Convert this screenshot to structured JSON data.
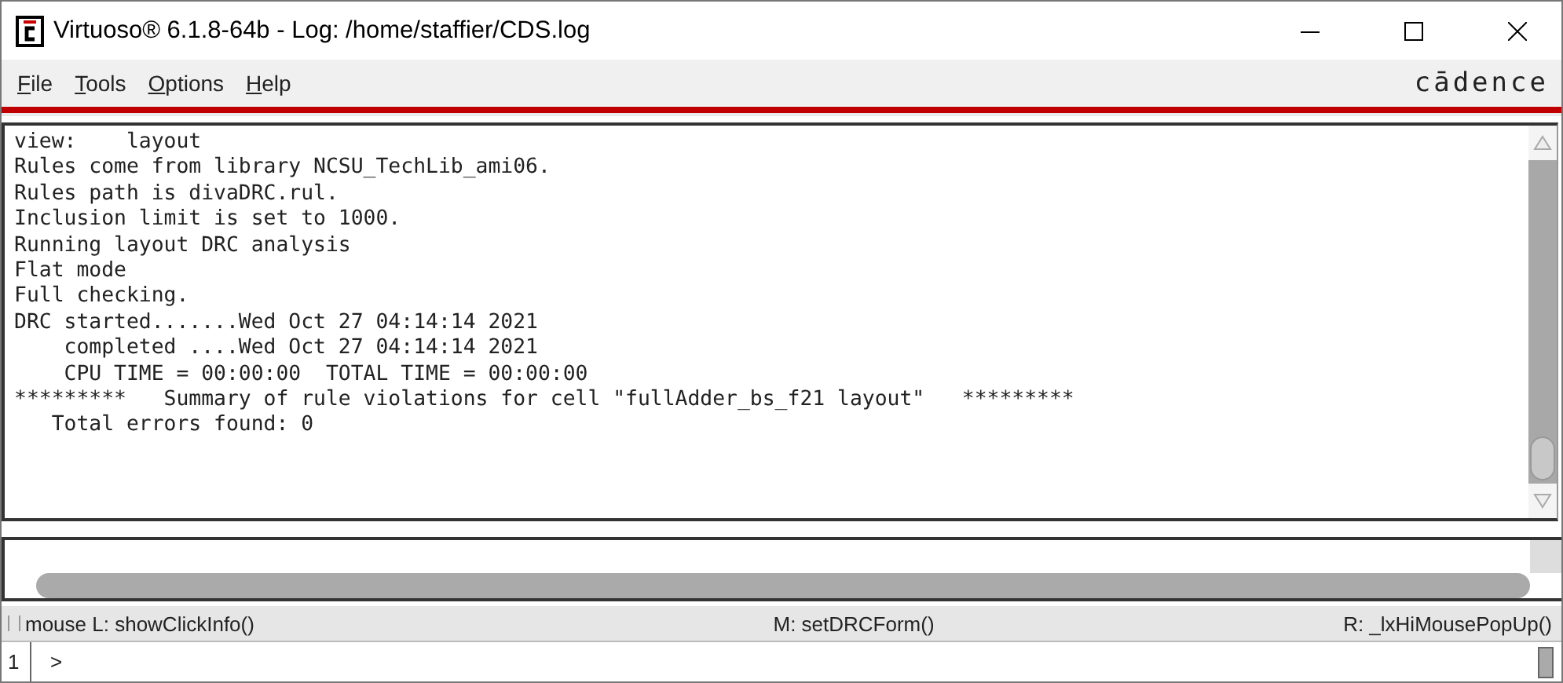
{
  "window": {
    "title": "Virtuoso® 6.1.8-64b - Log: /home/staffier/CDS.log"
  },
  "menu": [
    {
      "label": "File"
    },
    {
      "label": "Tools"
    },
    {
      "label": "Options"
    },
    {
      "label": "Help"
    }
  ],
  "brand": "cādence",
  "log": [
    "view:    layout",
    "Rules come from library NCSU_TechLib_ami06.",
    "Rules path is divaDRC.rul.",
    "Inclusion limit is set to 1000.",
    "Running layout DRC analysis",
    "Flat mode",
    "Full checking.",
    "DRC started.......Wed Oct 27 04:14:14 2021",
    "    completed ....Wed Oct 27 04:14:14 2021",
    "    CPU TIME = 00:00:00  TOTAL TIME = 00:00:00",
    "*********   Summary of rule violations for cell \"fullAdder_bs_f21 layout\"   *********",
    "   Total errors found: 0"
  ],
  "status_bar": {
    "left": "mouse L: showClickInfo()",
    "middle": "M: setDRCForm()",
    "right": "R: _lxHiMousePopUp()"
  },
  "prompt": {
    "number": "1",
    "symbol": ">"
  }
}
